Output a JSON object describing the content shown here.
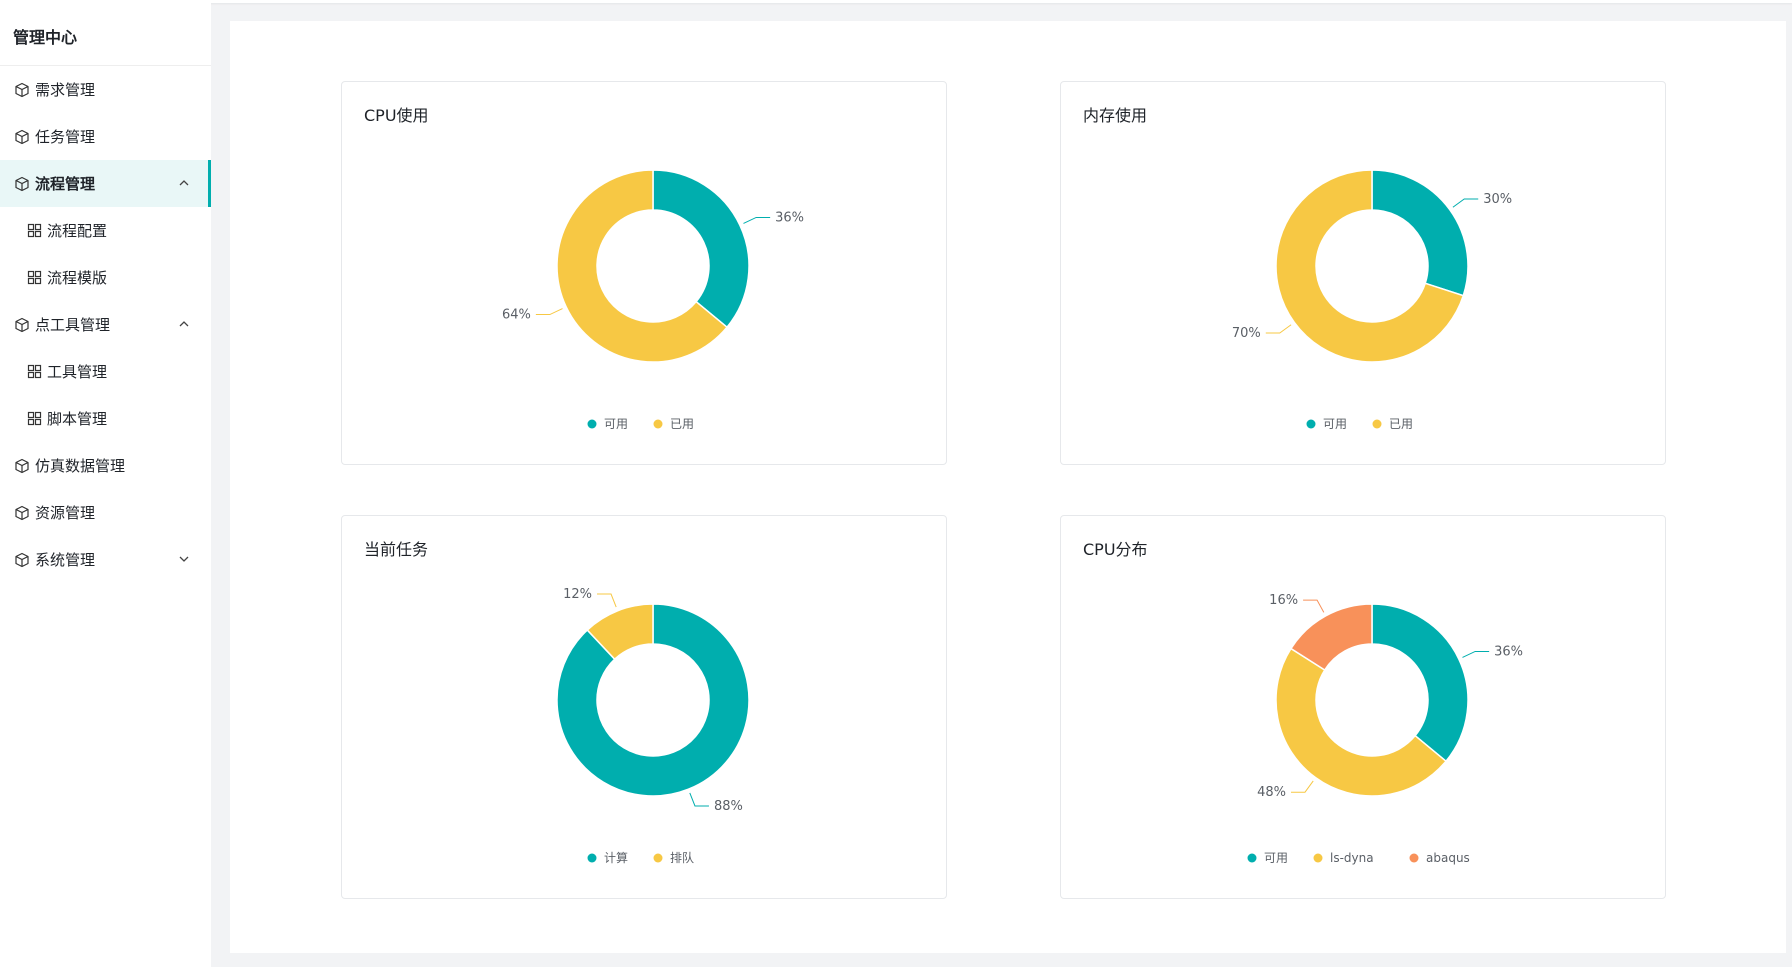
{
  "sidebar": {
    "title": "管理中心",
    "items": [
      {
        "label": "需求管理",
        "icon": "cube-icon"
      },
      {
        "label": "任务管理",
        "icon": "cube-icon"
      },
      {
        "label": "流程管理",
        "icon": "cube-icon",
        "expanded": true,
        "active": true
      },
      {
        "label": "流程配置",
        "icon": "grid-icon",
        "sub": true
      },
      {
        "label": "流程模版",
        "icon": "grid-icon",
        "sub": true
      },
      {
        "label": "点工具管理",
        "icon": "cube-icon",
        "expanded": true
      },
      {
        "label": "工具管理",
        "icon": "grid-icon",
        "sub": true
      },
      {
        "label": "脚本管理",
        "icon": "grid-icon",
        "sub": true
      },
      {
        "label": "仿真数据管理",
        "icon": "cube-icon"
      },
      {
        "label": "资源管理",
        "icon": "cube-icon"
      },
      {
        "label": "系统管理",
        "icon": "cube-icon",
        "expanded": false
      }
    ]
  },
  "colors": {
    "teal": "#00aeae",
    "yellow": "#f7c844",
    "orange": "#f8915a",
    "accent": "#00aeae"
  },
  "cards": [
    {
      "title": "CPU使用"
    },
    {
      "title": "内存使用"
    },
    {
      "title": "当前任务"
    },
    {
      "title": "CPU分布"
    }
  ],
  "chart_data": [
    {
      "type": "pie",
      "title": "CPU使用",
      "series": [
        {
          "name": "可用",
          "value": 36,
          "label": "36%",
          "color": "#00aeae"
        },
        {
          "name": "已用",
          "value": 64,
          "label": "64%",
          "color": "#f7c844"
        }
      ],
      "legend": "bottom-center"
    },
    {
      "type": "pie",
      "title": "内存使用",
      "series": [
        {
          "name": "可用",
          "value": 30,
          "label": "30%",
          "color": "#00aeae"
        },
        {
          "name": "已用",
          "value": 70,
          "label": "70%",
          "color": "#f7c844"
        }
      ],
      "legend": "bottom-center"
    },
    {
      "type": "pie",
      "title": "当前任务",
      "series": [
        {
          "name": "计算",
          "value": 88,
          "label": "88%",
          "color": "#00aeae"
        },
        {
          "name": "排队",
          "value": 12,
          "label": "12%",
          "color": "#f7c844"
        }
      ],
      "legend": "bottom-center"
    },
    {
      "type": "pie",
      "title": "CPU分布",
      "series": [
        {
          "name": "可用",
          "value": 36,
          "label": "36%",
          "color": "#00aeae"
        },
        {
          "name": "ls-dyna",
          "value": 48,
          "label": "48%",
          "color": "#f7c844"
        },
        {
          "name": "abaqus",
          "value": 16,
          "label": "16%",
          "color": "#f8915a"
        }
      ],
      "legend": "bottom-center"
    }
  ]
}
